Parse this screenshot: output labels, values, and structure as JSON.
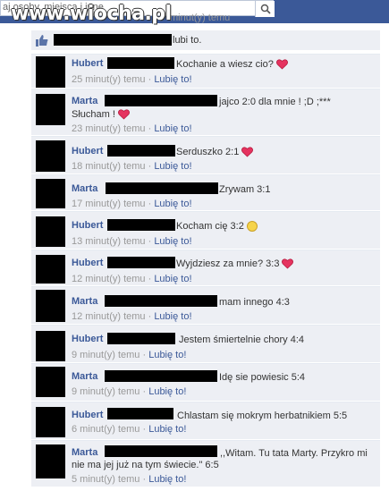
{
  "search": {
    "placeholder": "aj osoby, miejsca i inne"
  },
  "watermark": "www.wiocha.pl",
  "prev_time": "minut(y) temu",
  "like_bar": {
    "text": "lubi to."
  },
  "comments": [
    {
      "author": "Hubert",
      "text": "Kochanie a wiesz cio?",
      "icon": "heart-icon",
      "time": "25 minut(y) temu",
      "sep": " · ",
      "like": "Lubię to!"
    },
    {
      "author": "Marta",
      "text": "jajco 2:0 dla mnie ! ;D ;***",
      "text2": "Słucham !",
      "icon": "heart-icon",
      "time": "23 minut(y) temu",
      "sep": " · ",
      "like": "Lubię to!"
    },
    {
      "author": "Hubert",
      "text": "Serduszko 2:1",
      "icon": "heart-icon",
      "time": "18 minut(y) temu",
      "sep": " · ",
      "like": "Lubię to!"
    },
    {
      "author": "Marta",
      "text": "Zrywam 3:1",
      "time": "17 minut(y) temu",
      "sep": " · ",
      "like": "Lubię to!"
    },
    {
      "author": "Hubert",
      "text": "Kocham cię 3:2",
      "icon": "smile-icon",
      "time": "13 minut(y) temu",
      "sep": " · ",
      "like": "Lubię to!"
    },
    {
      "author": "Hubert",
      "text": "Wyjdziesz za mnie? 3:3",
      "icon": "heart-icon",
      "time": "12 minut(y) temu",
      "sep": " · ",
      "like": "Lubię to!"
    },
    {
      "author": "Marta",
      "text": "mam innego 4:3",
      "time": "12 minut(y) temu",
      "sep": " · ",
      "like": "Lubię to!"
    },
    {
      "author": "Hubert",
      "text": "Jestem śmiertelnie chory 4:4",
      "time": "9 minut(y) temu",
      "sep": " · ",
      "like": "Lubię to!"
    },
    {
      "author": "Marta",
      "text": "Idę sie powiesic 5:4",
      "time": "9 minut(y) temu",
      "sep": " · ",
      "like": "Lubię to!"
    },
    {
      "author": "Hubert",
      "text": "Chlastam się mokrym herbatnikiem 5:5",
      "time": "6 minut(y) temu",
      "sep": " · ",
      "like": "Lubię to!"
    },
    {
      "author": "Marta",
      "text": ",,Witam. Tu tata Marty. Przykro mi",
      "text2": "nie ma jej już na tym świecie.\" 6:5",
      "time": "5 minut(y) temu",
      "sep": " · ",
      "like": "Lubię to!"
    }
  ],
  "colors": {
    "link": "#3b5998",
    "comment_bg": "#edeff4",
    "heart": "#e5335f"
  }
}
